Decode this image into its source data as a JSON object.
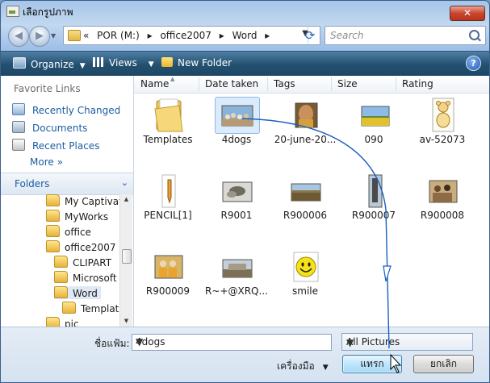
{
  "window": {
    "title": "เลือกรูปภาพ",
    "close_label": "✕"
  },
  "nav": {
    "breadcrumb": [
      "«",
      "POR (M:)",
      "▸",
      "office2007",
      "▸",
      "Word",
      "▸"
    ],
    "search_placeholder": "Search"
  },
  "toolbar": {
    "organize": "Organize",
    "views": "Views",
    "new_folder": "New Folder",
    "help": "?"
  },
  "left": {
    "favorites_header": "Favorite Links",
    "favorites": [
      "Recently Changed",
      "Documents",
      "Recent Places"
    ],
    "more": "More  »",
    "folders_label": "Folders",
    "tree": [
      {
        "label": "My Captivate",
        "indent": 1
      },
      {
        "label": "MyWorks",
        "indent": 1
      },
      {
        "label": "office",
        "indent": 1
      },
      {
        "label": "office2007",
        "indent": 1
      },
      {
        "label": "CLIPART",
        "indent": 2
      },
      {
        "label": "Microsoft C",
        "indent": 2
      },
      {
        "label": "Word",
        "indent": 2,
        "selected": true
      },
      {
        "label": "Template",
        "indent": 3
      },
      {
        "label": "pic",
        "indent": 1
      }
    ]
  },
  "columns": [
    "Name",
    "Date taken",
    "Tags",
    "Size",
    "Rating"
  ],
  "files": [
    {
      "label": "Templates",
      "kind": "folder"
    },
    {
      "label": "4dogs",
      "kind": "photo",
      "selected": true
    },
    {
      "label": "20-june-20...",
      "kind": "photo"
    },
    {
      "label": "090",
      "kind": "photo"
    },
    {
      "label": "av-52073",
      "kind": "clipart"
    },
    {
      "label": "PENCIL[1]",
      "kind": "pencil"
    },
    {
      "label": "R9001",
      "kind": "photo"
    },
    {
      "label": "R900006",
      "kind": "photo"
    },
    {
      "label": "R900007",
      "kind": "photo"
    },
    {
      "label": "R900008",
      "kind": "photo"
    },
    {
      "label": "R900009",
      "kind": "photo"
    },
    {
      "label": "R~+@XRQ...",
      "kind": "photo"
    },
    {
      "label": "smile",
      "kind": "smiley"
    }
  ],
  "bottom": {
    "filename_label": "ชื่อแฟ้ม:",
    "filename_value": "4dogs",
    "filter_value": "All Pictures",
    "tools_label": "เครื่องมือ",
    "open_label": "แทรก",
    "cancel_label": "ยกเลิก"
  },
  "colors": {
    "accent": "#1c5ea3",
    "toolbar": "#24506f",
    "annotation_arrow": "#1a5fc0"
  }
}
